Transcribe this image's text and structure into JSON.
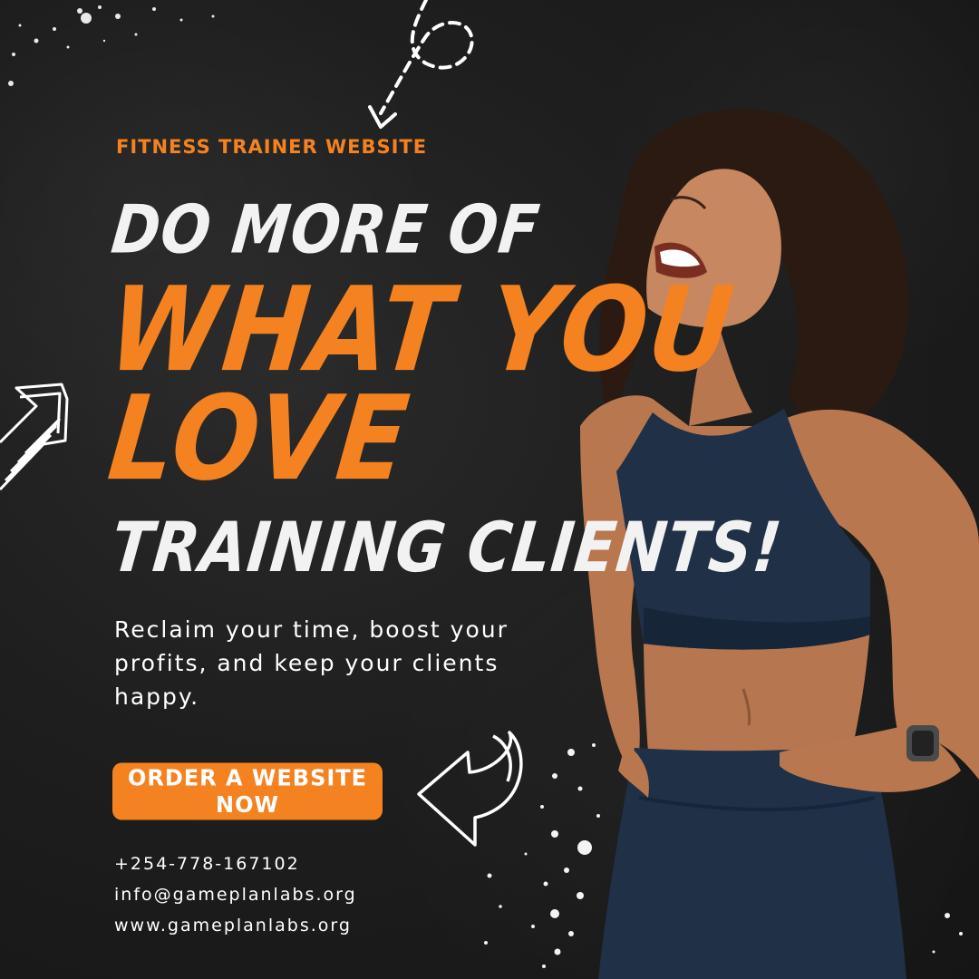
{
  "eyebrow": "FITNESS TRAINER WEBSITE",
  "headline": {
    "line1": "DO MORE OF",
    "line2": "WHAT YOU",
    "line3": "LOVE",
    "line4": "TRAINING CLIENTS!"
  },
  "body": "Reclaim your time, boost your profits, and keep your clients happy.",
  "cta_label": "ORDER A WEBSITE NOW",
  "contact": {
    "phone": "+254-778-167102",
    "email": "info@gameplanlabs.org",
    "website": "www.gameplanlabs.org"
  },
  "colors": {
    "accent": "#f58220",
    "background": "#1c1c1c",
    "text": "#ffffff",
    "outfit": "#1f3047"
  },
  "icons": [
    "dashed-arrow-icon",
    "sketch-arrow-up-right-icon",
    "curved-arrow-left-icon",
    "paint-splatter-icon"
  ]
}
